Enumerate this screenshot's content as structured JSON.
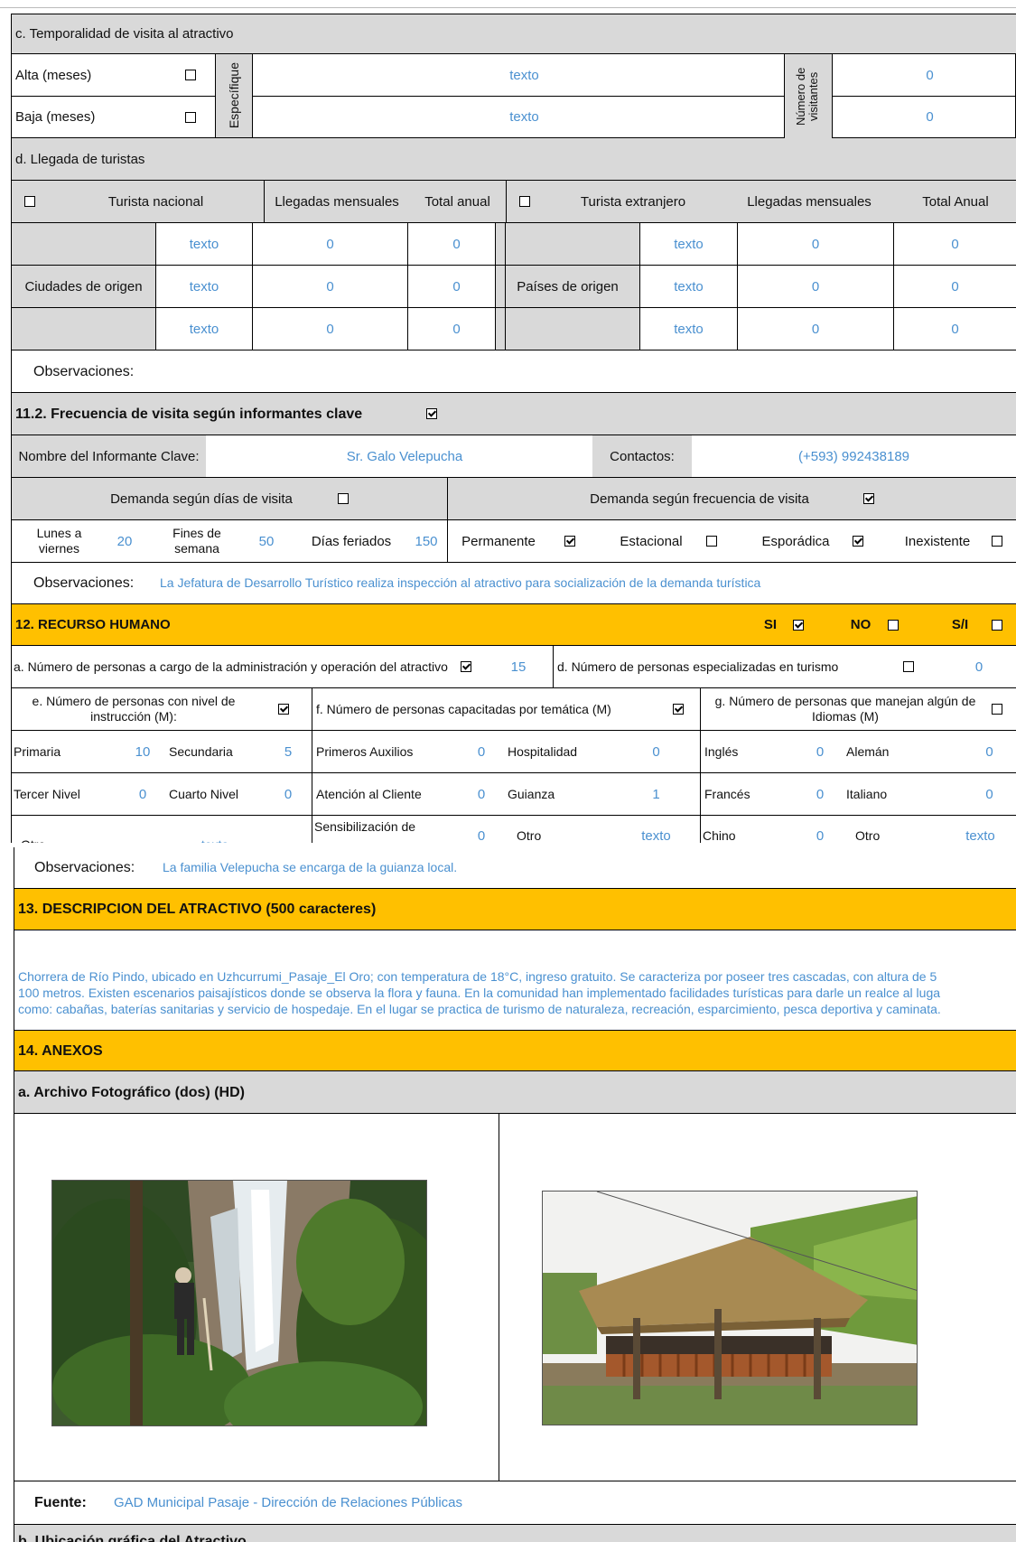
{
  "temporalidad": {
    "title": "c. Temporalidad de visita al atractivo",
    "alta_label": "Alta (meses)",
    "baja_label": "Baja (meses)",
    "especifique": "Específique",
    "alta_text": "texto",
    "baja_text": "texto",
    "num_visitantes": "Número de visitantes",
    "alta_num": "0",
    "baja_num": "0"
  },
  "llegada": {
    "title": "d. Llegada de turistas",
    "nacional": "Turista nacional",
    "llegadas_mensuales": "Llegadas mensuales",
    "total_anual": "Total anual",
    "extranjero": "Turista extranjero",
    "total_anual_ext": "Total Anual",
    "ciudades_origen": "Ciudades de origen",
    "paises_origen": "Países de origen",
    "rows": [
      {
        "c_text": "texto",
        "c_mes": "0",
        "c_total": "0",
        "p_text": "texto",
        "p_mes": "0",
        "p_total": "0"
      },
      {
        "c_text": "texto",
        "c_mes": "0",
        "c_total": "0",
        "p_text": "texto",
        "p_mes": "0",
        "p_total": "0"
      },
      {
        "c_text": "texto",
        "c_mes": "0",
        "c_total": "0",
        "p_text": "texto",
        "p_mes": "0",
        "p_total": "0"
      }
    ],
    "observaciones": "Observaciones:"
  },
  "frecuencia": {
    "title": "11.2. Frecuencia de visita según informantes clave",
    "nombre_label": "Nombre del Informante Clave:",
    "nombre_value": "Sr. Galo Velepucha",
    "contactos_label": "Contactos:",
    "contactos_value": "(+593) 992438189",
    "demanda_dias": "Demanda según  días de visita",
    "demanda_frec": "Demanda según frecuencia de visita",
    "lunes": "Lunes a viernes",
    "lunes_val": "20",
    "fines": "Fines de semana",
    "fines_val": "50",
    "feriados": "Días feriados",
    "feriados_val": "150",
    "permanente": "Permanente",
    "estacional": "Estacional",
    "esporadica": "Esporádica",
    "inexistente": "Inexistente",
    "obs_label": "Observaciones:",
    "obs_value": "La Jefatura de Desarrollo Turístico realiza inspección al atractivo para socialización de la demanda turística"
  },
  "recurso": {
    "title": "12. RECURSO HUMANO",
    "si": "SI",
    "no": "NO",
    "si_no": "S/I",
    "a_label": "a. Número de personas a cargo de la administración y operación del atractivo",
    "a_val": "15",
    "d_label": "d. Número de personas especializadas en turismo",
    "d_val": "0",
    "e_label": "e. Número de personas con nivel de instrucción (M):",
    "f_label": "f. Número de personas capacitadas por temática (M)",
    "g_label": "g. Número de personas que manejan algún de Idiomas (M)",
    "primaria": "Primaria",
    "primaria_val": "10",
    "secundaria": "Secundaria",
    "secundaria_val": "5",
    "primeros": "Primeros Auxilios",
    "primeros_val": "0",
    "hospitalidad": "Hospitalidad",
    "hospitalidad_val": "0",
    "ingles": "Inglés",
    "ingles_val": "0",
    "aleman": "Alemán",
    "aleman_val": "0",
    "tercer": "Tercer Nivel",
    "tercer_val": "0",
    "cuarto": "Cuarto Nivel",
    "cuarto_val": "0",
    "atencion": "Atención al Cliente",
    "atencion_val": "0",
    "guianza": "Guianza",
    "guianza_val": "1",
    "frances": "Francés",
    "frances_val": "0",
    "italiano": "Italiano",
    "italiano_val": "0",
    "otro1": "Otro",
    "otro1_val": "texto",
    "sensibilizacion": "Sensibilización de",
    "sensibilizacion_val": "0",
    "otro2": "Otro",
    "otro2_val": "texto",
    "chino": "Chino",
    "chino_val": "0",
    "otro3": "Otro",
    "otro3_val": "texto"
  },
  "obs2": {
    "label": "Observaciones:",
    "value": "La familia Velepucha se encarga de la guianza local."
  },
  "descripcion": {
    "title": "13. DESCRIPCION DEL ATRACTIVO (500 caracteres)",
    "line1": "Chorrera de Río Pindo, ubicado en Uzhcurrumi_Pasaje_El Oro; con temperatura de 18°C, ingreso  gratuito. Se  caracteriza por poseer tres cascadas, con altura de 5",
    "line2": "100 metros. Existen escenarios paisajísticos donde se observa la flora y fauna. En la comunidad  han implementado facilidades turísticas para darle un realce al luga",
    "line3": "como: cabañas, baterías sanitarias y servicio de hospedaje. En el lugar se practica de turismo de naturaleza, recreación,  esparcimiento, pesca deportiva y caminata."
  },
  "anexos": {
    "title": "14. ANEXOS",
    "archivo": "a. Archivo Fotográfico (dos) (HD)",
    "fuente_label": "Fuente:",
    "fuente_value": "GAD Municipal Pasaje - Dirección de Relaciones Públicas",
    "ubicacion": "b. Ubicación gráfica del Atractivo"
  },
  "colors": {
    "accent_orange": "#ffc000",
    "grey": "#d9d9d9",
    "value_blue": "#4a90d0"
  }
}
